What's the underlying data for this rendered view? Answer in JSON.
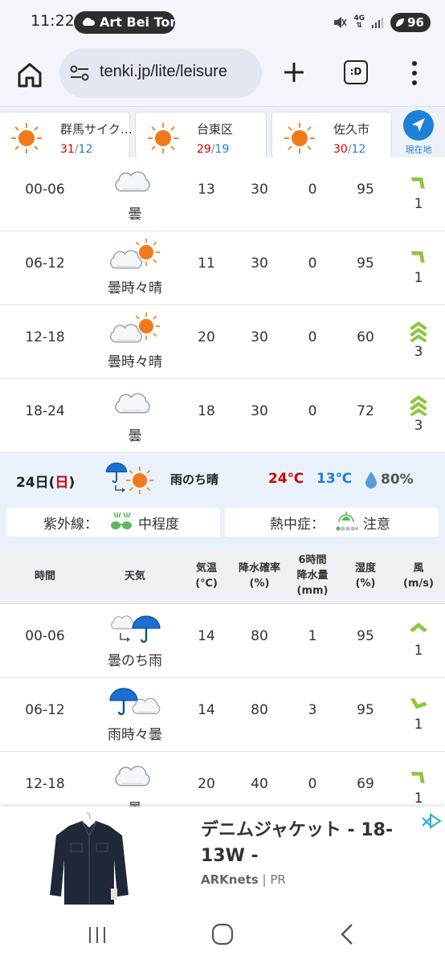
{
  "status_bar": {
    "time": "11:22",
    "media_label": "Art Bei Ton",
    "battery": "96",
    "network": "4G"
  },
  "browser": {
    "url": "tenki.jp/lite/leisure",
    "tabs_label": ":D"
  },
  "locations": [
    {
      "name": "群馬サイク…",
      "high": "31",
      "low": "12"
    },
    {
      "name": "台東区",
      "high": "29",
      "low": "19"
    },
    {
      "name": "佐久市",
      "high": "30",
      "low": "12"
    }
  ],
  "current_location_label": "現在地",
  "temp_separator": "/",
  "rows_day1": [
    {
      "time": "00-06",
      "weather": "曇",
      "temp": "13",
      "pop": "30",
      "rain": "0",
      "humidity": "95",
      "wind": "1"
    },
    {
      "time": "06-12",
      "weather": "曇時々晴",
      "temp": "11",
      "pop": "30",
      "rain": "0",
      "humidity": "95",
      "wind": "1"
    },
    {
      "time": "12-18",
      "weather": "曇時々晴",
      "temp": "20",
      "pop": "30",
      "rain": "0",
      "humidity": "60",
      "wind": "3"
    },
    {
      "time": "18-24",
      "weather": "曇",
      "temp": "18",
      "pop": "30",
      "rain": "0",
      "humidity": "72",
      "wind": "3"
    }
  ],
  "day2": {
    "date_prefix": "24日(",
    "weekday": "日",
    "date_suffix": ")",
    "weather": "雨のち晴",
    "high": "24℃",
    "low": "13℃",
    "pop": "80%",
    "uv_label": "紫外線：",
    "uv_value": "中程度",
    "heat_label": "熱中症：",
    "heat_value": "注意"
  },
  "table_headers": {
    "time": "時間",
    "weather": "天気",
    "temp_line1": "気温",
    "temp_line2": "(℃)",
    "pop_line1": "降水確率",
    "pop_line2": "(%)",
    "rain_line1": "6時間",
    "rain_line2": "降水量",
    "rain_line3": "(mm)",
    "hum_line1": "湿度",
    "hum_line2": "(%)",
    "wind_line1": "風",
    "wind_line2": "(m/s)"
  },
  "rows_day2": [
    {
      "time": "00-06",
      "weather": "曇のち雨",
      "temp": "14",
      "pop": "80",
      "rain": "1",
      "humidity": "95",
      "wind": "1"
    },
    {
      "time": "06-12",
      "weather": "雨時々曇",
      "temp": "14",
      "pop": "80",
      "rain": "3",
      "humidity": "95",
      "wind": "1"
    },
    {
      "time": "12-18",
      "weather": "曇",
      "temp": "20",
      "pop": "40",
      "rain": "0",
      "humidity": "69",
      "wind": "1"
    }
  ],
  "ad": {
    "title": "デニムジャケット - 18-13W -",
    "advertiser": "ARKnets",
    "separator": " | ",
    "pr": "PR"
  },
  "colors": {
    "temp_high": "#d40000",
    "temp_low": "#1e7fd6",
    "day_bg": "#e9f2fb",
    "wind_green": "#8dc63f"
  }
}
